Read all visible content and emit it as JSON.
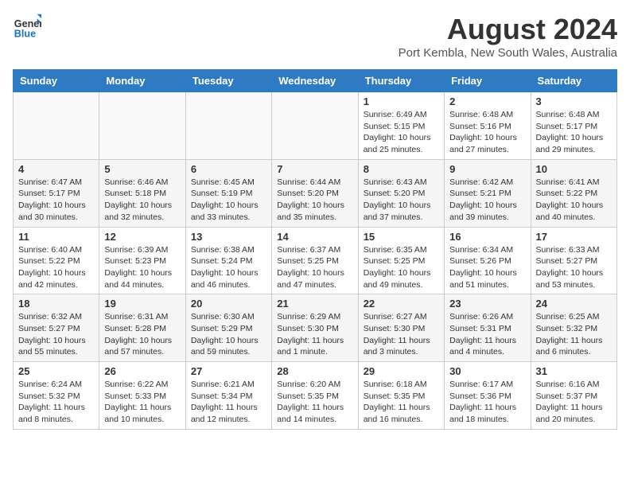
{
  "header": {
    "logo_line1": "General",
    "logo_line2": "Blue",
    "main_title": "August 2024",
    "subtitle": "Port Kembla, New South Wales, Australia"
  },
  "weekdays": [
    "Sunday",
    "Monday",
    "Tuesday",
    "Wednesday",
    "Thursday",
    "Friday",
    "Saturday"
  ],
  "weeks": [
    [
      {
        "day": "",
        "info": ""
      },
      {
        "day": "",
        "info": ""
      },
      {
        "day": "",
        "info": ""
      },
      {
        "day": "",
        "info": ""
      },
      {
        "day": "1",
        "info": "Sunrise: 6:49 AM\nSunset: 5:15 PM\nDaylight: 10 hours\nand 25 minutes."
      },
      {
        "day": "2",
        "info": "Sunrise: 6:48 AM\nSunset: 5:16 PM\nDaylight: 10 hours\nand 27 minutes."
      },
      {
        "day": "3",
        "info": "Sunrise: 6:48 AM\nSunset: 5:17 PM\nDaylight: 10 hours\nand 29 minutes."
      }
    ],
    [
      {
        "day": "4",
        "info": "Sunrise: 6:47 AM\nSunset: 5:17 PM\nDaylight: 10 hours\nand 30 minutes."
      },
      {
        "day": "5",
        "info": "Sunrise: 6:46 AM\nSunset: 5:18 PM\nDaylight: 10 hours\nand 32 minutes."
      },
      {
        "day": "6",
        "info": "Sunrise: 6:45 AM\nSunset: 5:19 PM\nDaylight: 10 hours\nand 33 minutes."
      },
      {
        "day": "7",
        "info": "Sunrise: 6:44 AM\nSunset: 5:20 PM\nDaylight: 10 hours\nand 35 minutes."
      },
      {
        "day": "8",
        "info": "Sunrise: 6:43 AM\nSunset: 5:20 PM\nDaylight: 10 hours\nand 37 minutes."
      },
      {
        "day": "9",
        "info": "Sunrise: 6:42 AM\nSunset: 5:21 PM\nDaylight: 10 hours\nand 39 minutes."
      },
      {
        "day": "10",
        "info": "Sunrise: 6:41 AM\nSunset: 5:22 PM\nDaylight: 10 hours\nand 40 minutes."
      }
    ],
    [
      {
        "day": "11",
        "info": "Sunrise: 6:40 AM\nSunset: 5:22 PM\nDaylight: 10 hours\nand 42 minutes."
      },
      {
        "day": "12",
        "info": "Sunrise: 6:39 AM\nSunset: 5:23 PM\nDaylight: 10 hours\nand 44 minutes."
      },
      {
        "day": "13",
        "info": "Sunrise: 6:38 AM\nSunset: 5:24 PM\nDaylight: 10 hours\nand 46 minutes."
      },
      {
        "day": "14",
        "info": "Sunrise: 6:37 AM\nSunset: 5:25 PM\nDaylight: 10 hours\nand 47 minutes."
      },
      {
        "day": "15",
        "info": "Sunrise: 6:35 AM\nSunset: 5:25 PM\nDaylight: 10 hours\nand 49 minutes."
      },
      {
        "day": "16",
        "info": "Sunrise: 6:34 AM\nSunset: 5:26 PM\nDaylight: 10 hours\nand 51 minutes."
      },
      {
        "day": "17",
        "info": "Sunrise: 6:33 AM\nSunset: 5:27 PM\nDaylight: 10 hours\nand 53 minutes."
      }
    ],
    [
      {
        "day": "18",
        "info": "Sunrise: 6:32 AM\nSunset: 5:27 PM\nDaylight: 10 hours\nand 55 minutes."
      },
      {
        "day": "19",
        "info": "Sunrise: 6:31 AM\nSunset: 5:28 PM\nDaylight: 10 hours\nand 57 minutes."
      },
      {
        "day": "20",
        "info": "Sunrise: 6:30 AM\nSunset: 5:29 PM\nDaylight: 10 hours\nand 59 minutes."
      },
      {
        "day": "21",
        "info": "Sunrise: 6:29 AM\nSunset: 5:30 PM\nDaylight: 11 hours\nand 1 minute."
      },
      {
        "day": "22",
        "info": "Sunrise: 6:27 AM\nSunset: 5:30 PM\nDaylight: 11 hours\nand 3 minutes."
      },
      {
        "day": "23",
        "info": "Sunrise: 6:26 AM\nSunset: 5:31 PM\nDaylight: 11 hours\nand 4 minutes."
      },
      {
        "day": "24",
        "info": "Sunrise: 6:25 AM\nSunset: 5:32 PM\nDaylight: 11 hours\nand 6 minutes."
      }
    ],
    [
      {
        "day": "25",
        "info": "Sunrise: 6:24 AM\nSunset: 5:32 PM\nDaylight: 11 hours\nand 8 minutes."
      },
      {
        "day": "26",
        "info": "Sunrise: 6:22 AM\nSunset: 5:33 PM\nDaylight: 11 hours\nand 10 minutes."
      },
      {
        "day": "27",
        "info": "Sunrise: 6:21 AM\nSunset: 5:34 PM\nDaylight: 11 hours\nand 12 minutes."
      },
      {
        "day": "28",
        "info": "Sunrise: 6:20 AM\nSunset: 5:35 PM\nDaylight: 11 hours\nand 14 minutes."
      },
      {
        "day": "29",
        "info": "Sunrise: 6:18 AM\nSunset: 5:35 PM\nDaylight: 11 hours\nand 16 minutes."
      },
      {
        "day": "30",
        "info": "Sunrise: 6:17 AM\nSunset: 5:36 PM\nDaylight: 11 hours\nand 18 minutes."
      },
      {
        "day": "31",
        "info": "Sunrise: 6:16 AM\nSunset: 5:37 PM\nDaylight: 11 hours\nand 20 minutes."
      }
    ]
  ]
}
